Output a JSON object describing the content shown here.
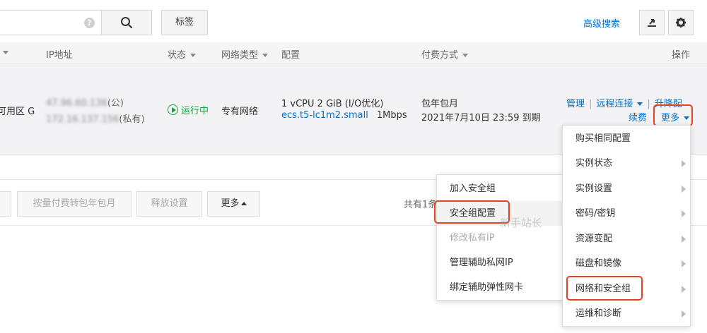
{
  "toolbar": {
    "clear_glyph": "?",
    "tag_label": "标签",
    "advanced_search": "高级搜索"
  },
  "table": {
    "headers": {
      "ip": "IP地址",
      "status": "状态",
      "network": "网络类型",
      "config": "配置",
      "billing": "付费方式",
      "actions": "操作"
    },
    "row": {
      "zone": "可用区 G",
      "public_ip": "47.96.60.136",
      "public_suffix": "(公)",
      "private_ip": "172.16.137.156",
      "private_suffix": "(私有)",
      "status": "运行中",
      "network": "专有网络",
      "config_line1": "1 vCPU 2 GiB (I/O优化)",
      "instance_type": "ecs.t5-lc1m2.small",
      "bandwidth": "1Mbps",
      "billing_line1": "包年包月",
      "billing_line2": "2021年7月10日 23:59 到期",
      "action_manage": "管理",
      "action_remote": "远程连接",
      "action_upgrade": "升降配",
      "action_renew": "续费",
      "action_more": "更多"
    }
  },
  "footer": {
    "btn_convert": "按量付费转包年包月",
    "btn_release": "释放设置",
    "btn_more": "更多",
    "total_text": "共有1条"
  },
  "more_menu": {
    "items": [
      "购买相同配置",
      "实例状态",
      "实例设置",
      "密码/密钥",
      "资源变配",
      "磁盘和镜像",
      "网络和安全组",
      "运维和诊断"
    ]
  },
  "submenu": {
    "items": [
      "加入安全组",
      "安全组配置",
      "修改私有IP",
      "管理辅助私网IP",
      "绑定辅助弹性网卡"
    ]
  },
  "watermark": "新手站长",
  "colors": {
    "link": "#0070cc",
    "running": "#0fa338",
    "highlight": "#e8411f"
  }
}
